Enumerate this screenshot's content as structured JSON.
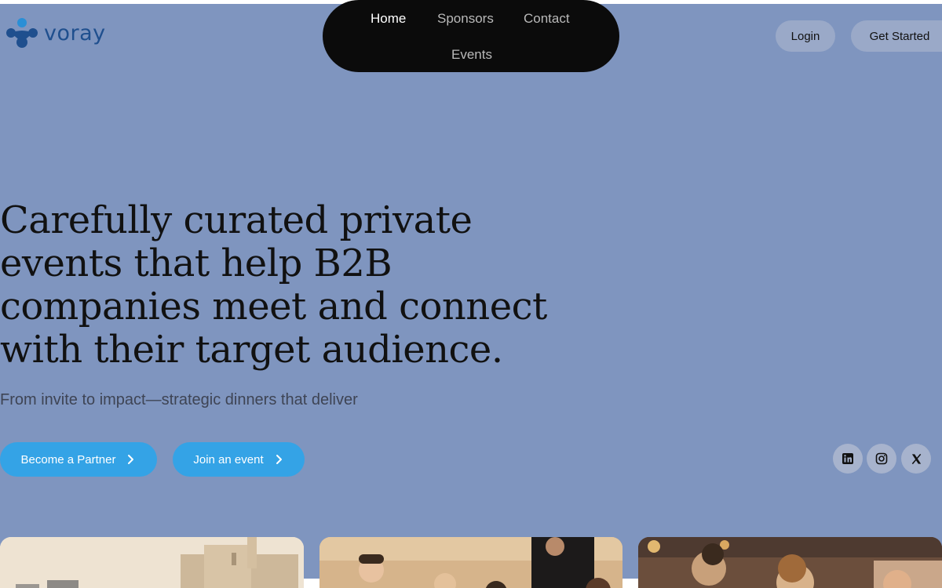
{
  "brand": {
    "name": "voray",
    "color": "#1f4f8e",
    "accent": "#2a8fd6"
  },
  "nav": {
    "items": [
      {
        "label": "Home",
        "active": true
      },
      {
        "label": "Sponsors",
        "active": false
      },
      {
        "label": "Contact",
        "active": false
      },
      {
        "label": "Events",
        "active": false
      }
    ]
  },
  "header": {
    "login_label": "Login",
    "get_started_label": "Get Started"
  },
  "hero": {
    "title": "Carefully curated private events that help B2B companies meet and connect with their target audience.",
    "subtitle": "From invite to impact—strategic dinners that deliver",
    "cta_partner": "Become a Partner",
    "cta_join": "Join an event"
  },
  "social": {
    "icons": [
      "linkedin-icon",
      "instagram-icon",
      "x-icon"
    ]
  },
  "colors": {
    "background": "#7f95bf",
    "nav_bg": "#0b0b0b",
    "cta": "#34a3e6",
    "header_button": "#9aa9c8"
  }
}
